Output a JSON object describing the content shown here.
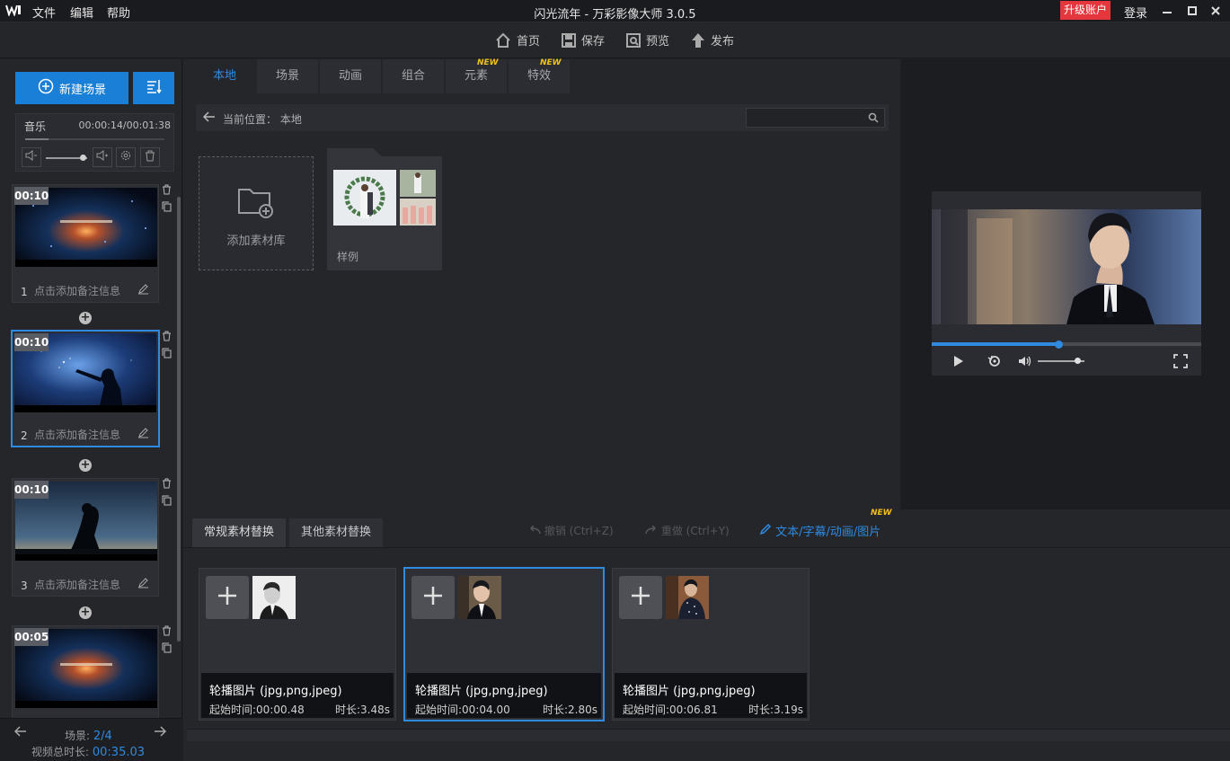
{
  "titlebar": {
    "logo": "W",
    "menu": [
      "文件",
      "编辑",
      "帮助"
    ],
    "title": "闪光流年 - 万彩影像大师 3.0.5",
    "upgrade": "升级账户",
    "login": "登录"
  },
  "toolbar": {
    "home": "首页",
    "save": "保存",
    "preview": "预览",
    "publish": "发布"
  },
  "left": {
    "new_scene": "新建场景",
    "music_label": "音乐",
    "music_time": "00:00:14/00:01:38",
    "music_progress": 0.17,
    "volume": 0.9,
    "scenes": [
      {
        "duration": "00:10",
        "number": "1",
        "note": "点击添加备注信息",
        "selected": false
      },
      {
        "duration": "00:10",
        "number": "2",
        "note": "点击添加备注信息",
        "selected": true
      },
      {
        "duration": "00:10",
        "number": "3",
        "note": "点击添加备注信息",
        "selected": false
      },
      {
        "duration": "00:05",
        "number": "",
        "note": "",
        "selected": false
      }
    ],
    "scene_count_label": "场景:",
    "scene_count_value": "2/4",
    "total_label": "视频总时长:",
    "total_value": "00:35.03"
  },
  "center": {
    "tabs": [
      "本地",
      "场景",
      "动画",
      "组合",
      "元素",
      "特效"
    ],
    "active_tab": "本地",
    "new_badge": "NEW",
    "path_label": "当前位置：",
    "path_value": "本地",
    "add_library": "添加素材库",
    "folder_label": "样例"
  },
  "player": {
    "progress": 0.47,
    "volume": 0.85
  },
  "bottom": {
    "tabs": [
      "常规素材替换",
      "其他素材替换"
    ],
    "undo": "撤销 (Ctrl+Z)",
    "redo": "重做 (Ctrl+Y)",
    "text_edit": "文本/字幕/动画/图片",
    "new_badge": "NEW",
    "cards": [
      {
        "title": "轮播图片 (jpg,png,jpeg)",
        "start": "起始时间:00:00.48",
        "length": "时长:3.48s",
        "selected": false
      },
      {
        "title": "轮播图片 (jpg,png,jpeg)",
        "start": "起始时间:00:04.00",
        "length": "时长:2.80s",
        "selected": true
      },
      {
        "title": "轮播图片 (jpg,png,jpeg)",
        "start": "起始时间:00:06.81",
        "length": "时长:3.19s",
        "selected": false
      }
    ]
  },
  "colors": {
    "accent": "#2f8ae0",
    "upgrade": "#e3363d",
    "new_badge": "#f0c020",
    "background": "#1f2024"
  },
  "icons": [
    "app-logo-icon",
    "minimize-icon",
    "maximize-icon",
    "close-icon",
    "home-icon",
    "save-icon",
    "preview-icon",
    "publish-icon",
    "plus-circle-icon",
    "sort-icon",
    "mute-icon",
    "volume-icon",
    "settings-icon",
    "trash-icon",
    "copy-icon",
    "edit-icon",
    "back-arrow-icon",
    "search-icon",
    "folder-add-icon",
    "play-icon",
    "loop-icon",
    "speaker-icon",
    "fullscreen-icon",
    "plus-icon",
    "pencil-icon",
    "arrow-left-icon",
    "arrow-right-icon"
  ]
}
